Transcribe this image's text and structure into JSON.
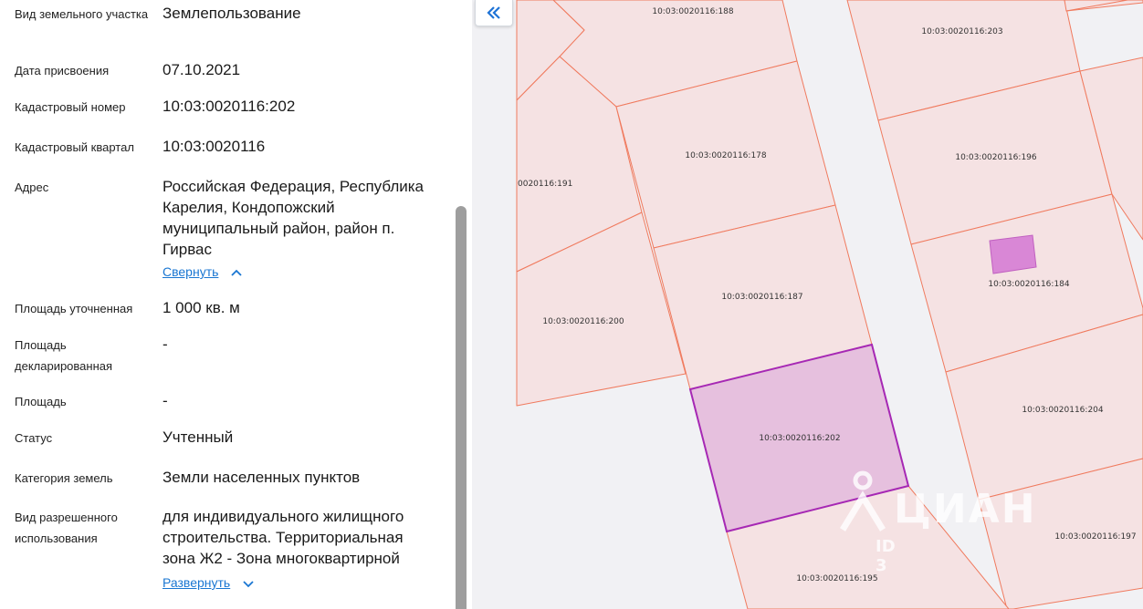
{
  "details": {
    "land_type": {
      "label": "Вид земельного участка",
      "value": "Землепользование"
    },
    "assigned_date": {
      "label": "Дата присвоения",
      "value": "07.10.2021"
    },
    "cadastral_number": {
      "label": "Кадастровый номер",
      "value": "10:03:0020116:202"
    },
    "cadastral_quarter": {
      "label": "Кадастровый квартал",
      "value": "10:03:0020116"
    },
    "address": {
      "label": "Адрес",
      "value": "Российская Федерация, Республика Карелия, Кондопожский муниципальный район, район п. Гирвас",
      "toggle": "Свернуть"
    },
    "area_refined": {
      "label": "Площадь уточненная",
      "value": "1 000 кв. м"
    },
    "area_declared": {
      "label": "Площадь декларированная",
      "value": "-"
    },
    "area": {
      "label": "Площадь",
      "value": "-"
    },
    "status": {
      "label": "Статус",
      "value": "Учтенный"
    },
    "land_category": {
      "label": "Категория земель",
      "value": "Земли населенных пунктов"
    },
    "permitted_use": {
      "label": "Вид разрешенного использования",
      "value": "для индивидуального жилищного строительства. Территориальная зона Ж2 - Зона многоквартирной",
      "toggle": "Развернуть"
    }
  },
  "map": {
    "parcels": [
      "10:03:0020116:188",
      "10:03:0020116:203",
      "10:03:0020116:178",
      "10:03:0020116:196",
      "0020116:191",
      "10:03:0020116:184",
      "10:03:0020116:187",
      "10:03:0020116:200",
      "10:03:0020116:202",
      "10:03:0020116:204",
      "10:03:0020116:197",
      "10:03:0020116:195"
    ],
    "colors": {
      "parcel_fill": "#f5e2e3",
      "parcel_border": "#f07a5e",
      "selected_fill": "#e6c0de",
      "selected_border": "#a628b4",
      "building_fill": "#d987d6",
      "road": "#f1f1f4"
    }
  },
  "watermark": {
    "brand": "ЦИАН",
    "id": "ID 3"
  }
}
